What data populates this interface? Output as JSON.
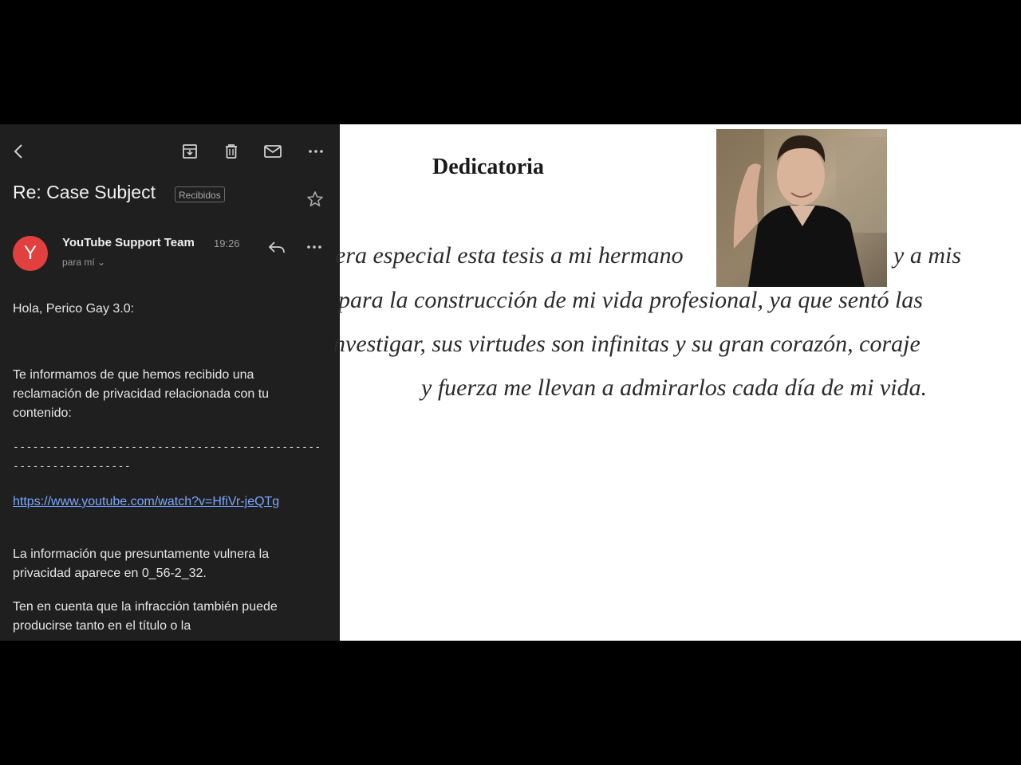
{
  "email": {
    "toolbar": {
      "icons": [
        "back-arrow-icon",
        "archive-icon",
        "trash-icon",
        "mail-icon",
        "more-icon"
      ]
    },
    "subject": "Re: Case Subject",
    "label": "Recibidos",
    "star_icon": "star-icon",
    "message": {
      "avatar_letter": "Y",
      "avatar_color": "#e2403e",
      "sender": "YouTube Support Team",
      "time": "19:26",
      "recipient": "para mí ⌄",
      "reply_icon": "reply-icon",
      "more_icon": "more-icon"
    },
    "body": {
      "greeting": "Hola, Perico Gay 3.0:",
      "intro": "Te informamos de que hemos recibido una reclamación de privacidad relacionada con tu contenido:",
      "divider": "-----------------------------------------------------------------",
      "link": "https://www.youtube.com/watch?v=HfiVr-jeQTg",
      "info": "La información que presuntamente vulnera la privacidad aparece en 0_56-2_32.",
      "note": "Ten en cuenta que la infracción también puede producirse tanto en el título o la"
    },
    "colors": {
      "background": "#1f1f1f",
      "link": "#7aa7ff"
    }
  },
  "document": {
    "title": "Dedicatoria",
    "lines": [
      "era especial esta tesis a mi hermano",
      "y a mis",
      "para la construcción de mi vida profesional, ya que sentó las",
      "nvestigar, sus virtudes son infinitas y su gran corazón, coraje",
      "y fuerza me llevan a admirarlos cada día de mi vida."
    ]
  }
}
